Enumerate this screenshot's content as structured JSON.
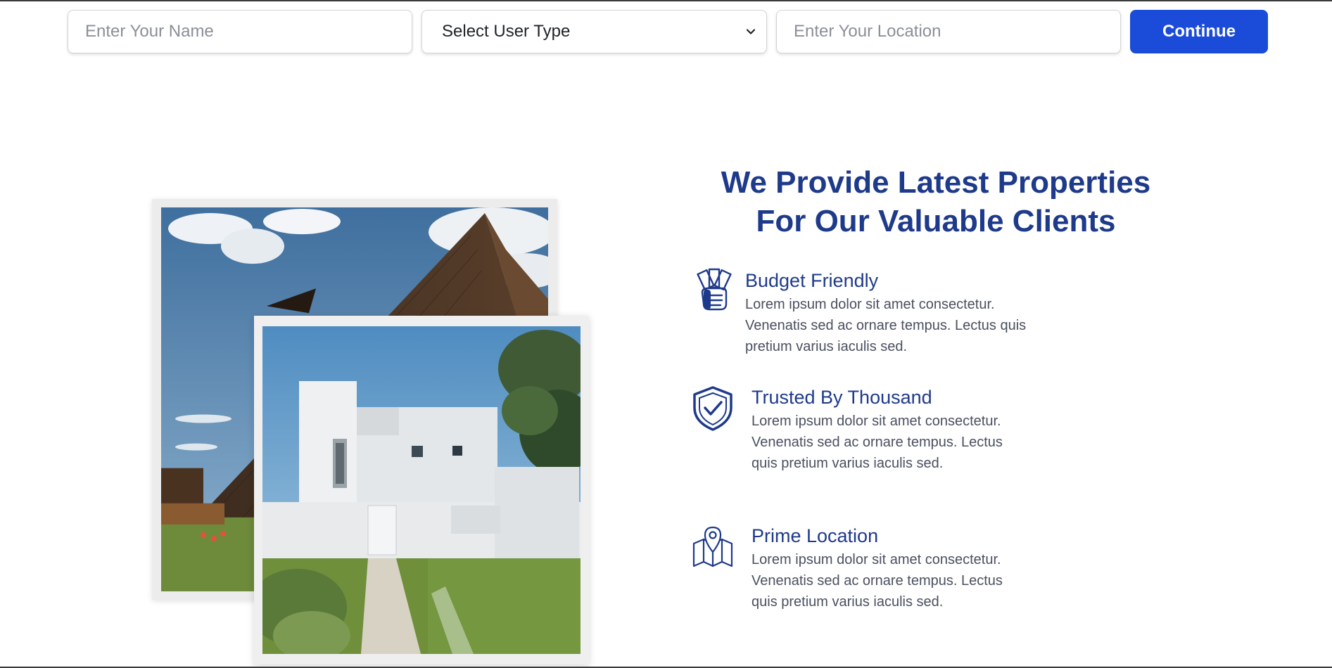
{
  "form": {
    "name_placeholder": "Enter Your Name",
    "user_type_selected": "Select User Type",
    "location_placeholder": "Enter Your Location",
    "continue_label": "Continue"
  },
  "section": {
    "heading_line1": "We Provide Latest Properties",
    "heading_line2": "For Our Valuable Clients"
  },
  "features": [
    {
      "icon": "money-hand-icon",
      "title": "Budget Friendly",
      "description": "Lorem ipsum dolor sit amet consectetur. Venenatis sed ac ornare tempus. Lectus quis pretium varius iaculis sed."
    },
    {
      "icon": "shield-check-icon",
      "title": "Trusted By Thousand",
      "description": "Lorem ipsum dolor sit amet consectetur. Venenatis sed ac ornare tempus. Lectus quis pretium varius iaculis sed."
    },
    {
      "icon": "map-pin-icon",
      "title": "Prime Location",
      "description": "Lorem ipsum dolor sit amet consectetur. Venenatis sed ac ornare tempus. Lectus quis pretium varius iaculis sed."
    }
  ],
  "colors": {
    "primary_button": "#1b4bd9",
    "heading": "#1e3a8a",
    "body_text": "#4b5060"
  }
}
